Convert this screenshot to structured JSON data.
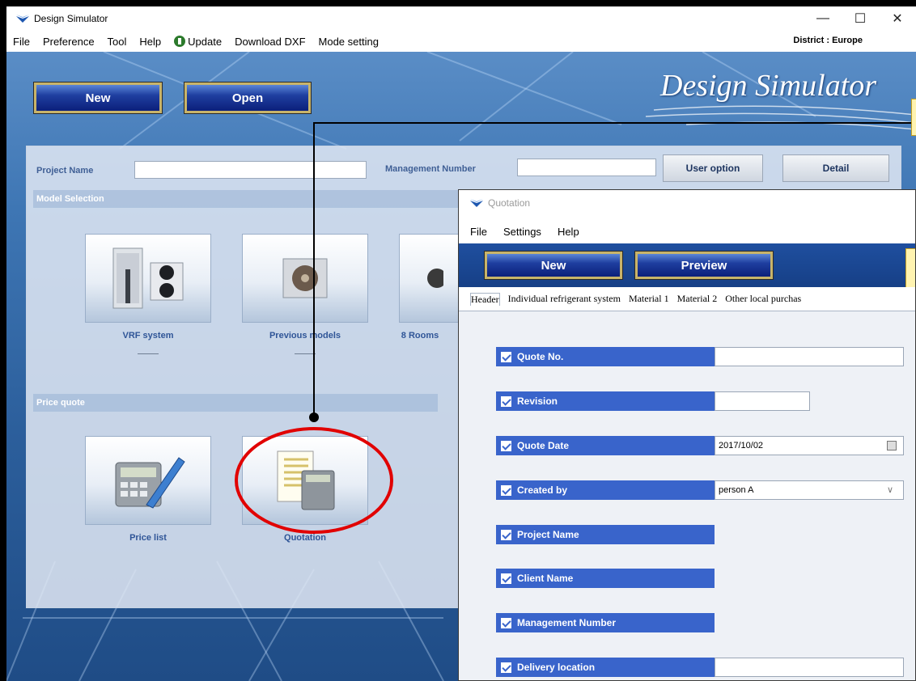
{
  "window": {
    "title": "Design Simulator",
    "controls": {
      "minimize": "—",
      "maximize": "☐",
      "close": "✕"
    }
  },
  "menubar": {
    "items": [
      "File",
      "Preference",
      "Tool",
      "Help",
      "Update",
      "Download DXF",
      "Mode setting"
    ],
    "district": "District : Europe"
  },
  "toolbar": {
    "new_label": "New",
    "open_label": "Open"
  },
  "brand": "Design Simulator",
  "project": {
    "name_label": "Project Name",
    "name_value": "",
    "mgmt_label": "Management Number",
    "mgmt_value": "",
    "user_option": "User option",
    "detail": "Detail"
  },
  "model_selection": {
    "title": "Model Selection",
    "tiles": [
      {
        "label": "VRF system",
        "dash": "-----"
      },
      {
        "label": "Previous models",
        "dash": "-----"
      },
      {
        "label": "8 Rooms",
        "dash": ""
      }
    ]
  },
  "price_quote": {
    "title": "Price quote",
    "tiles": [
      {
        "label": "Price list"
      },
      {
        "label": "Quotation"
      }
    ]
  },
  "quotation": {
    "title": "Quotation",
    "menu": [
      "File",
      "Settings",
      "Help"
    ],
    "new_label": "New",
    "preview_label": "Preview",
    "tabs": [
      "Header",
      "Individual refrigerant system",
      "Material 1",
      "Material 2",
      "Other local purchas"
    ],
    "fields": [
      {
        "label": "Quote No.",
        "value": ""
      },
      {
        "label": "Revision",
        "value": ""
      },
      {
        "label": "Quote Date",
        "value": "2017/10/02"
      },
      {
        "label": "Created by",
        "value": "person A"
      },
      {
        "label": "Project Name",
        "value": ""
      },
      {
        "label": "Client Name",
        "value": ""
      },
      {
        "label": "Management Number",
        "value": ""
      },
      {
        "label": "Delivery location",
        "value": ""
      }
    ]
  },
  "colors": {
    "accent_blue": "#3964cb",
    "highlight_ring": "#e10000",
    "callout": "#fff3b0"
  }
}
